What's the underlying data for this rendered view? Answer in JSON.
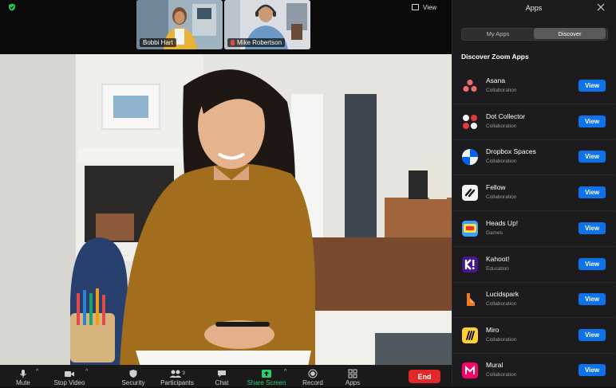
{
  "meeting": {
    "view_label": "View",
    "participants": [
      {
        "name": "Bobbi Hart"
      },
      {
        "name": "Mike Robertson"
      }
    ]
  },
  "toolbar": {
    "items": [
      {
        "label": "Mute",
        "icon": "mic-icon"
      },
      {
        "label": "Stop Video",
        "icon": "video-icon"
      },
      {
        "label": "Security",
        "icon": "shield-icon"
      },
      {
        "label": "Participants",
        "icon": "participants-icon",
        "count": "3"
      },
      {
        "label": "Chat",
        "icon": "chat-icon"
      },
      {
        "label": "Share Screen",
        "icon": "share-screen-icon"
      },
      {
        "label": "Record",
        "icon": "record-icon"
      },
      {
        "label": "Apps",
        "icon": "apps-icon"
      }
    ],
    "end_label": "End"
  },
  "apps_panel": {
    "title": "Apps",
    "tabs": [
      {
        "label": "My Apps",
        "selected": false
      },
      {
        "label": "Discover",
        "selected": true
      }
    ],
    "heading": "Discover Zoom Apps",
    "button_label": "View",
    "apps": [
      {
        "name": "Asana",
        "category": "Collaboration",
        "icon": "asana-icon"
      },
      {
        "name": "Dot Collector",
        "category": "Collaboration",
        "icon": "dot-collector-icon"
      },
      {
        "name": "Dropbox Spaces",
        "category": "Collaboration",
        "icon": "dropbox-spaces-icon"
      },
      {
        "name": "Fellow",
        "category": "Collaboration",
        "icon": "fellow-icon"
      },
      {
        "name": "Heads Up!",
        "category": "Games",
        "icon": "heads-up-icon"
      },
      {
        "name": "Kahoot!",
        "category": "Education",
        "icon": "kahoot-icon"
      },
      {
        "name": "Lucidspark",
        "category": "Collaboration",
        "icon": "lucidspark-icon"
      },
      {
        "name": "Miro",
        "category": "Collaboration",
        "icon": "miro-icon"
      },
      {
        "name": "Mural",
        "category": "Collaboration",
        "icon": "mural-icon"
      }
    ]
  },
  "colors": {
    "accent": "#0e72ed",
    "end": "#e02828",
    "share": "#2ecc71",
    "panel_bg": "#1c1c1e"
  }
}
